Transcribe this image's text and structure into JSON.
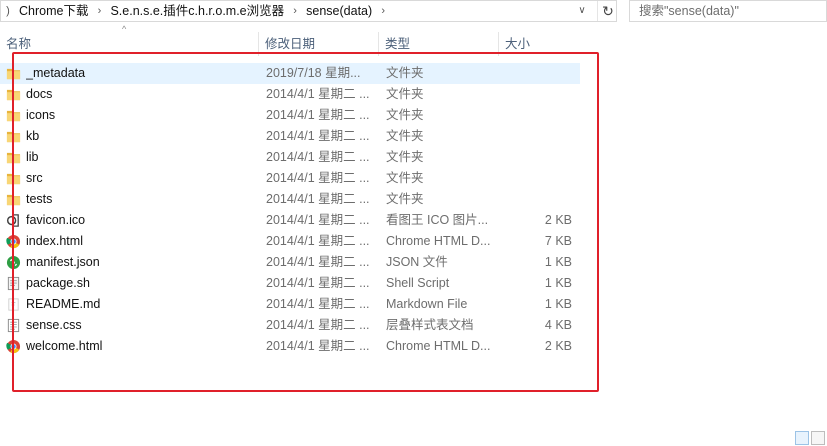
{
  "address": {
    "crumbs": [
      "Chrome下载",
      "S.e.n.s.e.插件c.h.r.o.m.e浏览器",
      "sense(data)"
    ]
  },
  "search": {
    "placeholder": "搜索\"sense(data)\""
  },
  "columns": {
    "name": "名称",
    "date": "修改日期",
    "type": "类型",
    "size": "大小"
  },
  "files": [
    {
      "name": "_metadata",
      "date": "2019/7/18 星期...",
      "type": "文件夹",
      "size": "",
      "icon": "folder-icon"
    },
    {
      "name": "docs",
      "date": "2014/4/1 星期二 ...",
      "type": "文件夹",
      "size": "",
      "icon": "folder-icon"
    },
    {
      "name": "icons",
      "date": "2014/4/1 星期二 ...",
      "type": "文件夹",
      "size": "",
      "icon": "folder-icon"
    },
    {
      "name": "kb",
      "date": "2014/4/1 星期二 ...",
      "type": "文件夹",
      "size": "",
      "icon": "folder-icon"
    },
    {
      "name": "lib",
      "date": "2014/4/1 星期二 ...",
      "type": "文件夹",
      "size": "",
      "icon": "folder-icon"
    },
    {
      "name": "src",
      "date": "2014/4/1 星期二 ...",
      "type": "文件夹",
      "size": "",
      "icon": "folder-icon"
    },
    {
      "name": "tests",
      "date": "2014/4/1 星期二 ...",
      "type": "文件夹",
      "size": "",
      "icon": "folder-icon"
    },
    {
      "name": "favicon.ico",
      "date": "2014/4/1 星期二 ...",
      "type": "看图王 ICO 图片...",
      "size": "2 KB",
      "icon": "image-viewer-icon"
    },
    {
      "name": "index.html",
      "date": "2014/4/1 星期二 ...",
      "type": "Chrome HTML D...",
      "size": "7 KB",
      "icon": "chrome-icon"
    },
    {
      "name": "manifest.json",
      "date": "2014/4/1 星期二 ...",
      "type": "JSON 文件",
      "size": "1 KB",
      "icon": "json-icon"
    },
    {
      "name": "package.sh",
      "date": "2014/4/1 星期二 ...",
      "type": "Shell Script",
      "size": "1 KB",
      "icon": "script-file-icon"
    },
    {
      "name": "README.md",
      "date": "2014/4/1 星期二 ...",
      "type": "Markdown File",
      "size": "1 KB",
      "icon": "markdown-file-icon"
    },
    {
      "name": "sense.css",
      "date": "2014/4/1 星期二 ...",
      "type": "层叠样式表文档",
      "size": "4 KB",
      "icon": "css-file-icon"
    },
    {
      "name": "welcome.html",
      "date": "2014/4/1 星期二 ...",
      "type": "Chrome HTML D...",
      "size": "2 KB",
      "icon": "chrome-icon"
    }
  ],
  "selected_index": 0,
  "colors": {
    "selection": "#e5f3ff",
    "highlight_box": "#e0202a",
    "header_text": "#4c607a",
    "folder": "#f4c955"
  }
}
